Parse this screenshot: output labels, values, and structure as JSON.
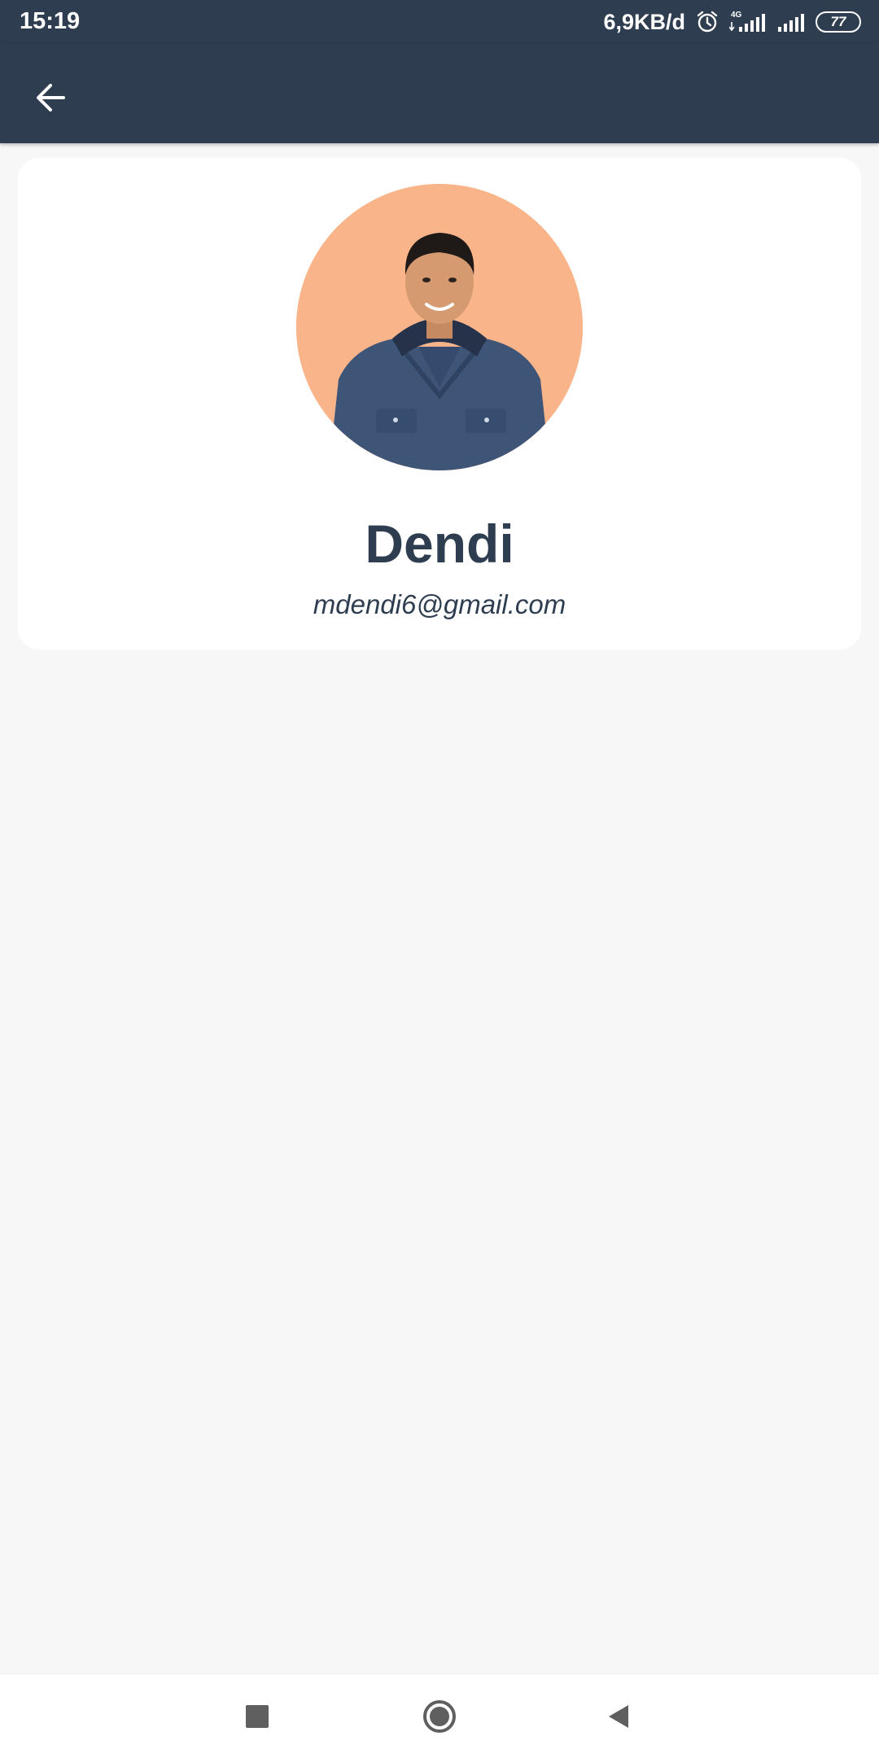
{
  "status_bar": {
    "time": "15:19",
    "network_speed": "6,9KB/d",
    "network_type": "4G",
    "battery_level": "77",
    "icons": [
      "alarm-icon",
      "signal-4g-icon",
      "signal-icon",
      "battery-icon"
    ]
  },
  "app_bar": {
    "back_icon": "arrow-left-icon"
  },
  "profile": {
    "name": "Dendi",
    "email": "mdendi6@gmail.com",
    "avatar_icon": "profile-photo"
  },
  "nav_bar": {
    "items": [
      "recents-icon",
      "home-icon",
      "back-icon"
    ]
  },
  "colors": {
    "primary": "#2e3d50",
    "background": "#f7f7f7",
    "card": "#ffffff",
    "avatar_bg": "#f9b48a"
  }
}
